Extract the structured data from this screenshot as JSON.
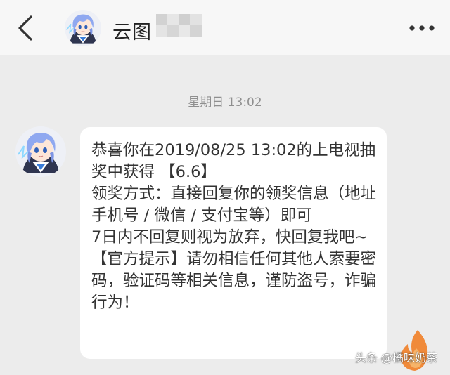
{
  "header": {
    "contact_name": "云图",
    "back_icon": "chevron-left-icon",
    "more_icon": "more-horizontal-icon"
  },
  "chat": {
    "timestamp": "星期日 13:02",
    "message_text": "恭喜你在2019/08/25 13:02的上电视抽奖中获得 【6.6】\n领奖方式：直接回复你的领奖信息（地址手机号 / 微信 / 支付宝等）即可\n7日内不回复则视为放弃，快回复我吧~\n【官方提示】请勿相信任何其他人索要密码，验证码等相关信息，谨防盗号，诈骗行为！"
  },
  "watermark": "头条 @橘味奶茶",
  "colors": {
    "background": "#ececec",
    "header_bg": "#f7f7f7",
    "bubble_bg": "#ffffff",
    "text": "#333333",
    "timestamp": "#8f8f8f"
  }
}
